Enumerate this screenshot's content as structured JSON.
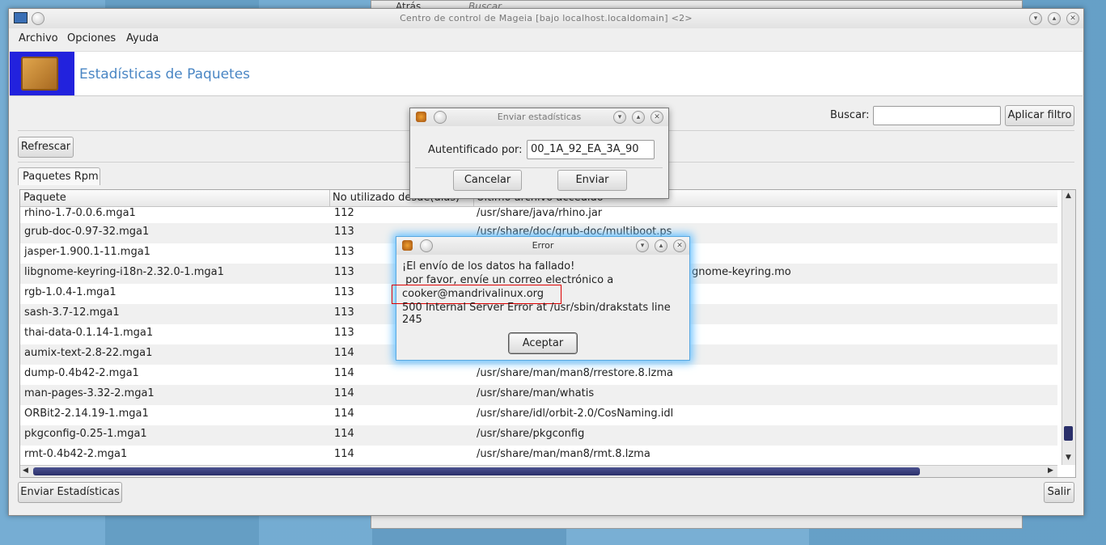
{
  "background_window": {
    "back_label": "Atrás",
    "search_placeholder": "Buscar..."
  },
  "window": {
    "title": "Centro de control de Mageia  [bajo localhost.localdomain] <2>"
  },
  "menu": [
    "Archivo",
    "Opciones",
    "Ayuda"
  ],
  "banner": {
    "title": "Estadísticas de Paquetes"
  },
  "search": {
    "label": "Buscar:",
    "value": "",
    "apply_label": "Aplicar filtro"
  },
  "refresh_label": "Refrescar",
  "tab_label": "Paquetes Rpm",
  "table": {
    "columns": [
      "Paquete",
      "No utilizado desde(días)",
      "Último archivo accedido"
    ],
    "rows": [
      [
        "rhino-1.7-0.0.6.mga1",
        "112",
        "/usr/share/java/rhino.jar"
      ],
      [
        "grub-doc-0.97-32.mga1",
        "113",
        "/usr/share/doc/grub-doc/multiboot.ps"
      ],
      [
        "jasper-1.900.1-11.mga1",
        "113",
        ""
      ],
      [
        "libgnome-keyring-i18n-2.32.0-1.mga1",
        "113",
        "gnome-keyring.mo"
      ],
      [
        "rgb-1.0.4-1.mga1",
        "113",
        ""
      ],
      [
        "sash-3.7-12.mga1",
        "113",
        ""
      ],
      [
        "thai-data-0.1.14-1.mga1",
        "113",
        ""
      ],
      [
        "aumix-text-2.8-22.mga1",
        "114",
        ""
      ],
      [
        "dump-0.4b42-2.mga1",
        "114",
        "/usr/share/man/man8/rrestore.8.lzma"
      ],
      [
        "man-pages-3.32-2.mga1",
        "114",
        "/usr/share/man/whatis"
      ],
      [
        "ORBit2-2.14.19-1.mga1",
        "114",
        "/usr/share/idl/orbit-2.0/CosNaming.idl"
      ],
      [
        "pkgconfig-0.25-1.mga1",
        "114",
        "/usr/share/pkgconfig"
      ],
      [
        "rmt-0.4b42-2.mga1",
        "114",
        "/usr/share/man/man8/rmt.8.lzma"
      ]
    ]
  },
  "footer": {
    "send_label": "Enviar Estadísticas",
    "quit_label": "Salir"
  },
  "send_dialog": {
    "title": "Enviar estadísticas",
    "auth_label": "Autentificado por:",
    "auth_value": "00_1A_92_EA_3A_90",
    "cancel_label": "Cancelar",
    "send_label": "Enviar"
  },
  "error_dialog": {
    "title": "Error",
    "line1": "¡El envío de los datos ha fallado!",
    "line2": " por favor, envíe un correo electrónico a",
    "email": "cooker@mandrivalinux.org",
    "line4": "500 Internal Server Error at /usr/sbin/drakstats line 245",
    "ok_label": "Aceptar"
  }
}
